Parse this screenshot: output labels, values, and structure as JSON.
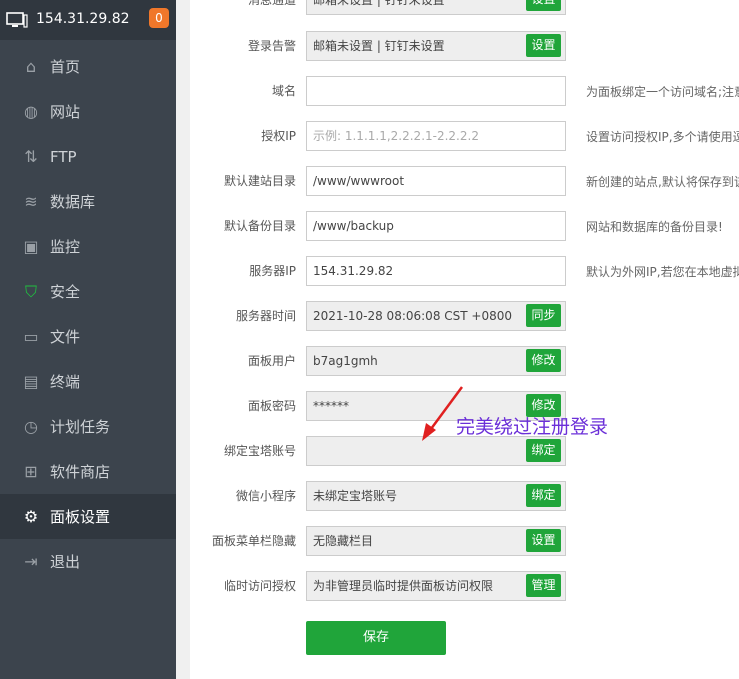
{
  "header": {
    "server_ip": "154.31.29.82",
    "badge_count": "0"
  },
  "sidebar": {
    "items": [
      {
        "label": "首页",
        "icon": "home-icon",
        "glyph": "⌂"
      },
      {
        "label": "网站",
        "icon": "globe-icon",
        "glyph": "◍"
      },
      {
        "label": "FTP",
        "icon": "ftp-icon",
        "glyph": "⇅"
      },
      {
        "label": "数据库",
        "icon": "database-icon",
        "glyph": "≋"
      },
      {
        "label": "监控",
        "icon": "monitor-chart-icon",
        "glyph": "▣"
      },
      {
        "label": "安全",
        "icon": "shield-icon",
        "glyph": "⛉"
      },
      {
        "label": "文件",
        "icon": "folder-icon",
        "glyph": "▭"
      },
      {
        "label": "终端",
        "icon": "terminal-icon",
        "glyph": "▤"
      },
      {
        "label": "计划任务",
        "icon": "clock-icon",
        "glyph": "◷"
      },
      {
        "label": "软件商店",
        "icon": "grid-icon",
        "glyph": "⊞"
      },
      {
        "label": "面板设置",
        "icon": "gear-icon",
        "glyph": "⚙"
      },
      {
        "label": "退出",
        "icon": "logout-icon",
        "glyph": "⇥"
      }
    ],
    "active_label": "面板设置"
  },
  "settings": {
    "rows": [
      {
        "label": "消息通道",
        "value": "邮箱未设置 | 钉钉未设置",
        "button": "设置"
      },
      {
        "label": "登录告警",
        "value": "邮箱未设置 | 钉钉未设置",
        "button": "设置"
      },
      {
        "label": "域名",
        "value": "",
        "hint": "为面板绑定一个访问域名;注意"
      },
      {
        "label": "授权IP",
        "placeholder": "示例: 1.1.1.1,2.2.2.1-2.2.2.2",
        "hint": "设置访问授权IP,多个请使用逗"
      },
      {
        "label": "默认建站目录",
        "value": "/www/wwwroot",
        "hint": "新创建的站点,默认将保存到该"
      },
      {
        "label": "默认备份目录",
        "value": "/www/backup",
        "hint": "网站和数据库的备份目录!"
      },
      {
        "label": "服务器IP",
        "value": "154.31.29.82",
        "hint": "默认为外网IP,若您在本地虚拟"
      },
      {
        "label": "服务器时间",
        "value": "2021-10-28 08:06:08 CST +0800",
        "button": "同步"
      },
      {
        "label": "面板用户",
        "value": "b7ag1gmh",
        "button": "修改"
      },
      {
        "label": "面板密码",
        "value": "******",
        "button": "修改"
      },
      {
        "label": "绑定宝塔账号",
        "value": "",
        "button": "绑定"
      },
      {
        "label": "微信小程序",
        "value": "未绑定宝塔账号",
        "button": "绑定"
      },
      {
        "label": "面板菜单栏隐藏",
        "value": "无隐藏栏目",
        "button": "设置"
      },
      {
        "label": "临时访问授权",
        "value": "为非管理员临时提供面板访问权限",
        "button": "管理"
      }
    ],
    "save_label": "保存"
  },
  "annotation": {
    "text": "完美绕过注册登录",
    "color": "#6b2fd8"
  },
  "colors": {
    "accent": "#20a53a",
    "sidebar_bg": "#3c444d",
    "badge": "#f0772a"
  }
}
